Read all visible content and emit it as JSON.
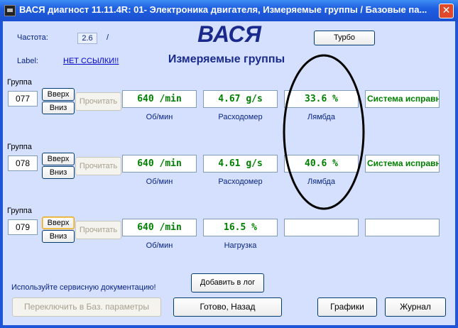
{
  "window": {
    "title": "ВАСЯ диагност 11.11.4R: 01- Электроника двигателя,  Измеряемые группы / Базовые па...",
    "close_glyph": "✕"
  },
  "header": {
    "freq_label": "Частота:",
    "freq_value": "2.6",
    "freq_sep": "/",
    "app_name": "ВАСЯ",
    "turbo_label": "Турбо",
    "label_caption": "Label:",
    "label_link": "НЕТ ССЫЛКИ!!",
    "subtitle": "Измеряемые группы"
  },
  "groups": [
    {
      "caption": "Группа",
      "number": "077",
      "up": "Вверх",
      "down": "Вниз",
      "read": "Прочитать",
      "fields": [
        {
          "value": "640 /min",
          "unit": "Об/мин"
        },
        {
          "value": "4.67 g/s",
          "unit": "Расходомер"
        },
        {
          "value": "33.6 %",
          "unit": "Лямбда"
        },
        {
          "value": "Система исправна",
          "unit": ""
        }
      ]
    },
    {
      "caption": "Группа",
      "number": "078",
      "up": "Вверх",
      "down": "Вниз",
      "read": "Прочитать",
      "fields": [
        {
          "value": "640 /min",
          "unit": "Об/мин"
        },
        {
          "value": "4.61 g/s",
          "unit": "Расходомер"
        },
        {
          "value": "40.6 %",
          "unit": "Лямбда"
        },
        {
          "value": "Система исправна",
          "unit": ""
        }
      ]
    },
    {
      "caption": "Группа",
      "number": "079",
      "up": "Вверх",
      "down": "Вниз",
      "read": "Прочитать",
      "fields": [
        {
          "value": "640 /min",
          "unit": "Об/мин"
        },
        {
          "value": "16.5 %",
          "unit": "Нагрузка"
        },
        {
          "value": "",
          "unit": ""
        },
        {
          "value": "",
          "unit": ""
        }
      ]
    }
  ],
  "footer": {
    "service_note": "Используйте сервисную документацию!",
    "add_log": "Добавить в лог",
    "switch_basic": "Переключить в Баз. параметры",
    "done_back": "Готово, Назад",
    "graphs": "Графики",
    "journal": "Журнал"
  },
  "colors": {
    "value_text": "#008000",
    "label_text": "#0a2484",
    "background": "#d4e0fd",
    "title_bar": "#1f5ee0"
  }
}
